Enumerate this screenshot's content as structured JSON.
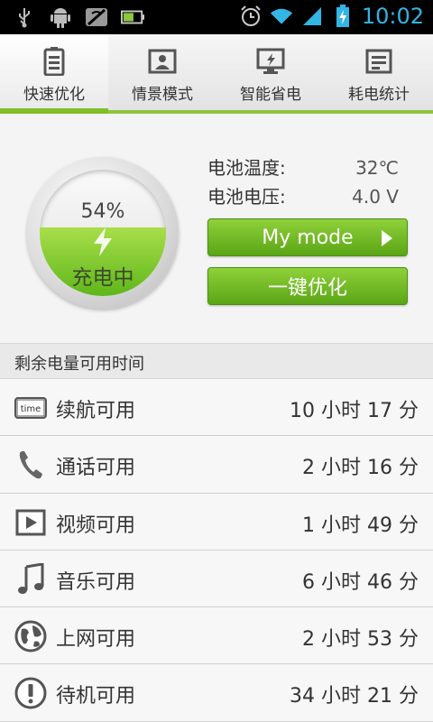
{
  "status_bar": {
    "time": "10:02",
    "icons_left": [
      "usb-icon",
      "android-icon",
      "no-sim-icon",
      "battery-app-icon"
    ],
    "icons_right": [
      "alarm-icon",
      "wifi-icon",
      "signal-icon",
      "battery-charging-icon"
    ]
  },
  "tabs": [
    {
      "label": "快速优化",
      "icon": "battery-tab-icon",
      "active": true
    },
    {
      "label": "情景模式",
      "icon": "picture-tab-icon",
      "active": false
    },
    {
      "label": "智能省电",
      "icon": "monitor-tab-icon",
      "active": false
    },
    {
      "label": "耗电统计",
      "icon": "list-tab-icon",
      "active": false
    }
  ],
  "battery": {
    "percent_text": "54%",
    "level": 0.54,
    "status": "充电中",
    "temp_label": "电池温度:",
    "temp_value": "32℃",
    "voltage_label": "电池电压:",
    "voltage_value": "4.0 V"
  },
  "buttons": {
    "mode": "My mode",
    "optimize": "一键优化"
  },
  "section_title": "剩余电量可用时间",
  "rows": [
    {
      "label": "续航可用",
      "value": "10 小时 17 分",
      "icon": "time-icon"
    },
    {
      "label": "通话可用",
      "value": "2 小时 16 分",
      "icon": "phone-icon"
    },
    {
      "label": "视频可用",
      "value": "1 小时 49 分",
      "icon": "video-icon"
    },
    {
      "label": "音乐可用",
      "value": "6 小时 46 分",
      "icon": "music-icon"
    },
    {
      "label": "上网可用",
      "value": "2 小时 53 分",
      "icon": "globe-icon"
    },
    {
      "label": "待机可用",
      "value": "34 小时 21 分",
      "icon": "standby-icon"
    }
  ],
  "colors": {
    "accent_green": "#7fbf2a",
    "time_blue": "#33b5e5"
  },
  "time_icon_text": "time"
}
